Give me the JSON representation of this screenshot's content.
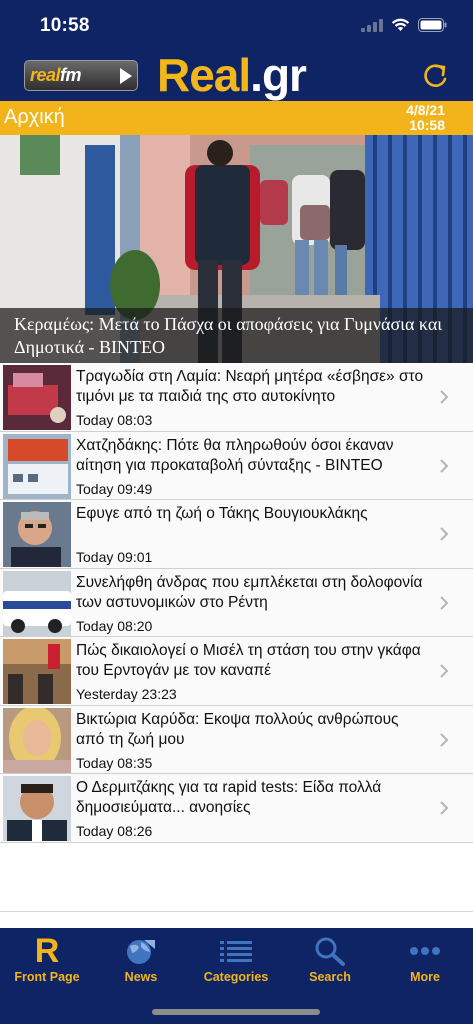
{
  "status_bar": {
    "time": "10:58"
  },
  "header": {
    "radio_logo_left": "real",
    "radio_logo_right": "fm",
    "site_logo_main": "Real",
    "site_logo_tld": ".gr"
  },
  "section": {
    "title": "Αρχική",
    "date": "4/8/21",
    "time": "10:58"
  },
  "hero": {
    "caption": "Κεραμέως: Μετά το Πάσχα οι αποφάσεις για Γυμνάσια και Δημοτικά - ΒΙΝΤΕΟ"
  },
  "news": [
    {
      "title": "Τραγωδία στη Λαμία: Νεαρή μητέρα «έσβησε» στο τιμόνι με τα παιδιά της στο αυτοκίνητο",
      "time": "Today 08:03"
    },
    {
      "title": "Χατζηδάκης: Πότε θα πληρωθούν όσοι έκαναν αίτηση για προκαταβολή σύνταξης - ΒΙΝΤΕΟ",
      "time": "Today 09:49"
    },
    {
      "title": "Εφυγε από τη ζωή ο Τάκης Βουγιουκλάκης",
      "time": "Today 09:01"
    },
    {
      "title": "Συνελήφθη άνδρας που εμπλέκεται στη δολοφονία των αστυνομικών στο Ρέντη",
      "time": "Today 08:20"
    },
    {
      "title": "Πώς δικαιολογεί ο Μισέλ τη στάση του στην γκάφα του Ερντογάν με τον καναπέ",
      "time": "Yesterday 23:23"
    },
    {
      "title": "Βικτώρια Καρύδα: Εκοψα πολλούς ανθρώπους από τη ζωή μου",
      "time": "Today 08:35"
    },
    {
      "title": "Ο Δερμιτζάκης για τα rapid tests: Είδα πολλά δημοσιεύματα... ανοησίες",
      "time": "Today 08:26"
    }
  ],
  "tabs": [
    {
      "label": "Front Page",
      "icon": "r-logo-icon"
    },
    {
      "label": "News",
      "icon": "globe-icon"
    },
    {
      "label": "Categories",
      "icon": "list-icon"
    },
    {
      "label": "Search",
      "icon": "search-icon"
    },
    {
      "label": "More",
      "icon": "more-dots-icon"
    }
  ],
  "colors": {
    "navy": "#0f2465",
    "accent": "#f3b41b",
    "tab_inactive": "#3e74c0"
  }
}
